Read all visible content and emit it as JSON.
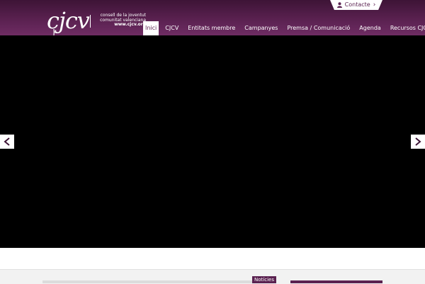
{
  "logo": {
    "mark": "cjcv",
    "line1": "consell de la joventut",
    "line2": "comunitat valenciana",
    "url": "www.cjcv.org"
  },
  "contact": {
    "label": "Contacte",
    "icon": "user-icon",
    "chevron": "›"
  },
  "nav": {
    "items": [
      {
        "label": "Inici",
        "active": true
      },
      {
        "label": "CJCV"
      },
      {
        "label": "Entitats membre"
      },
      {
        "label": "Campanyes"
      },
      {
        "label": "Premsa / Comunicació"
      },
      {
        "label": "Agenda"
      },
      {
        "label": "Recursos CJCV"
      }
    ]
  },
  "slider": {
    "prev_icon": "arrow-left-icon",
    "next_icon": "arrow-right-icon"
  },
  "news": {
    "tab_label": "Notícies"
  },
  "colors": {
    "brand": "#5a2150",
    "header_dark": "#3d1436",
    "slider_bg": "#000000"
  }
}
